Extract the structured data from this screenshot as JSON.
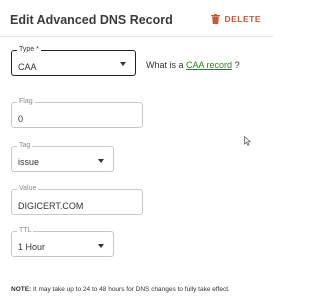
{
  "header": {
    "title": "Edit Advanced DNS Record",
    "delete_label": "DELETE"
  },
  "type_field": {
    "label": "Type *",
    "value": "CAA"
  },
  "help": {
    "prefix": "What is a",
    "link": "CAA record",
    "suffix": "?"
  },
  "flag_field": {
    "label": "Flag",
    "value": "0"
  },
  "tag_field": {
    "label": "Tag",
    "value": "issue"
  },
  "value_field": {
    "label": "Value",
    "value": "DIGICERT.COM"
  },
  "ttl_field": {
    "label": "TTL",
    "value": "1 Hour"
  },
  "note": {
    "label": "NOTE:",
    "text": "It may take up to 24 to 48 hours for DNS changes to fully take effect."
  },
  "colors": {
    "delete": "#c9562e",
    "link": "#2f7d2f"
  }
}
